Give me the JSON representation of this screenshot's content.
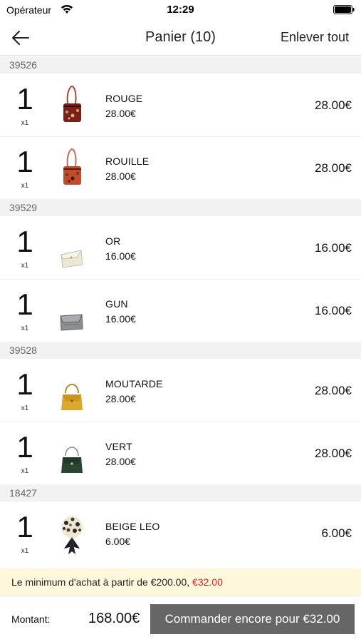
{
  "status_bar": {
    "carrier": "Opérateur",
    "time": "12:29",
    "wifi_icon": "wifi-icon",
    "battery_icon": "battery-icon"
  },
  "nav": {
    "back_icon": "back-arrow-icon",
    "title": "Panier (10)",
    "clear_all_label": "Enlever tout"
  },
  "groups": [
    {
      "ref": "39526",
      "items": [
        {
          "qty": "1",
          "qty_label": "x1",
          "name": "ROUGE",
          "unit_price": "28.00€",
          "total": "28.00€",
          "thumb": "red-bag",
          "color": "#8e2a22"
        },
        {
          "qty": "1",
          "qty_label": "x1",
          "name": "ROUILLE",
          "unit_price": "28.00€",
          "total": "28.00€",
          "thumb": "rust-bag",
          "color": "#c04a2c"
        }
      ]
    },
    {
      "ref": "39529",
      "items": [
        {
          "qty": "1",
          "qty_label": "x1",
          "name": "OR",
          "unit_price": "16.00€",
          "total": "16.00€",
          "thumb": "gold-clutch",
          "color": "#e6e1cf"
        },
        {
          "qty": "1",
          "qty_label": "x1",
          "name": "GUN",
          "unit_price": "16.00€",
          "total": "16.00€",
          "thumb": "gun-clutch",
          "color": "#8a8c8c"
        }
      ]
    },
    {
      "ref": "39528",
      "items": [
        {
          "qty": "1",
          "qty_label": "x1",
          "name": "MOUTARDE",
          "unit_price": "28.00€",
          "total": "28.00€",
          "thumb": "mustard-bag",
          "color": "#d9a52a"
        },
        {
          "qty": "1",
          "qty_label": "x1",
          "name": "VERT",
          "unit_price": "28.00€",
          "total": "28.00€",
          "thumb": "green-bag",
          "color": "#2a4630"
        }
      ]
    },
    {
      "ref": "18427",
      "items": [
        {
          "qty": "1",
          "qty_label": "x1",
          "name": "BEIGE LEO",
          "unit_price": "6.00€",
          "total": "6.00€",
          "thumb": "leopard-scarf",
          "color": "#cdbb98"
        }
      ]
    }
  ],
  "notice": {
    "text": "Le minimum d'achat à partir de €200.00, ",
    "missing": "€32.00",
    "missing_color": "#e02020",
    "background": "#fdf8dc"
  },
  "footer": {
    "amount_label": "Montant:",
    "amount": "168.00€",
    "order_button": "Commander encore pour €32.00",
    "button_color": "#666666"
  }
}
